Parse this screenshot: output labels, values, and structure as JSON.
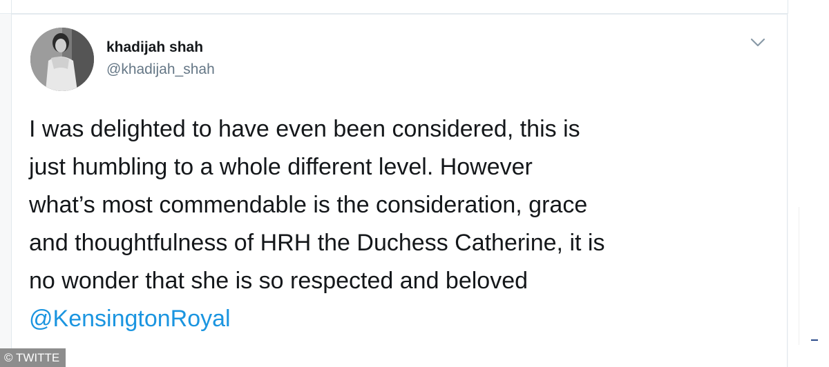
{
  "tweet": {
    "author": {
      "display_name": "khadijah shah",
      "handle": "@khadijah_shah",
      "avatar_icon": "profile-photo"
    },
    "menu_icon": "chevron-down-icon",
    "text_lines": [
      "I was delighted to have even been considered, this is",
      "just humbling to a whole different level. However",
      "what’s most commendable is the consideration, grace",
      "and thoughtfulness of HRH the Duchess Catherine, it is",
      "no wonder that she is so respected and beloved"
    ],
    "mention": "@KensingtonRoyal"
  },
  "credit": "© TWITTE",
  "colors": {
    "text": "#14171a",
    "secondary": "#657786",
    "link": "#1b95e0",
    "credit_bg": "#8d8d8d"
  }
}
